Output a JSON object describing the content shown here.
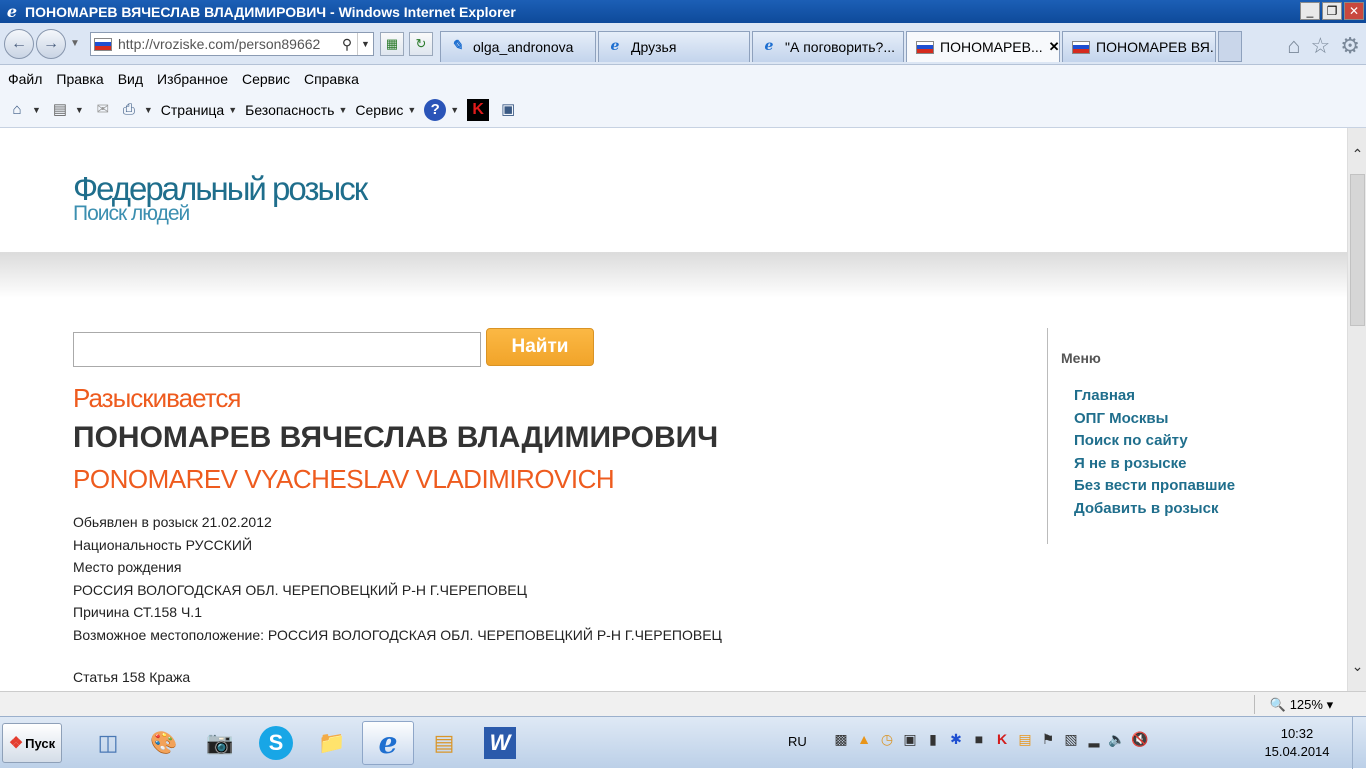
{
  "window": {
    "title": "ПОНОМАРЕВ ВЯЧЕСЛАВ ВЛАДИМИРОВИЧ - Windows Internet Explorer",
    "minimize": "_",
    "restore": "❐",
    "close": "✕"
  },
  "address": {
    "url": "http://vroziske.com/person89662"
  },
  "tabs": [
    {
      "label": "olga_andronova",
      "icon": "pencil-icon"
    },
    {
      "label": "Друзья",
      "icon": "ie-icon"
    },
    {
      "label": "\"А поговорить?...",
      "icon": "ie-icon"
    },
    {
      "label": "ПОНОМАРЕВ...",
      "icon": "russia-flag-icon",
      "close": "✕",
      "active": true
    },
    {
      "label": "ПОНОМАРЕВ ВЯ...",
      "icon": "russia-flag-icon"
    }
  ],
  "menubar": [
    "Файл",
    "Правка",
    "Вид",
    "Избранное",
    "Сервис",
    "Справка"
  ],
  "commandbar": {
    "page": "Страница",
    "safety": "Безопасность",
    "tools": "Сервис"
  },
  "site": {
    "title": "Федеральный розыск",
    "subtitle": "Поиск людей",
    "search_button": "Найти",
    "search_value": "",
    "status": "Разыскивается",
    "name_ru": "ПОНОМАРЕВ ВЯЧЕСЛАВ ВЛАДИМИРОВИЧ",
    "name_en": "PONOMAREV VYACHESLAV VLADIMIROVICH",
    "details": [
      "Обьявлен в розыск 21.02.2012",
      "Национальность РУССКИЙ",
      "Место рождения",
      "РОССИЯ ВОЛОГОДСКАЯ ОБЛ. ЧЕРЕПОВЕЦКИЙ Р-Н Г.ЧЕРЕПОВЕЦ",
      "Причина СТ.158 Ч.1",
      "Возможное местоположение: РОССИЯ ВОЛОГОДСКАЯ ОБЛ. ЧЕРЕПОВЕЦКИЙ Р-Н Г.ЧЕРЕПОВЕЦ"
    ],
    "article": "Статья 158 Кража"
  },
  "sidebar": {
    "heading": "Меню",
    "items": [
      "Главная",
      "ОПГ Москвы",
      "Поиск по сайту",
      "Я не в розыске",
      "Без вести пропавшие",
      "Добавить в розыск"
    ]
  },
  "statusbar": {
    "zoom": "🔍 125% ▾"
  },
  "taskbar": {
    "start": "Пуск",
    "lang": "RU",
    "time": "10:32",
    "date": "15.04.2014"
  }
}
